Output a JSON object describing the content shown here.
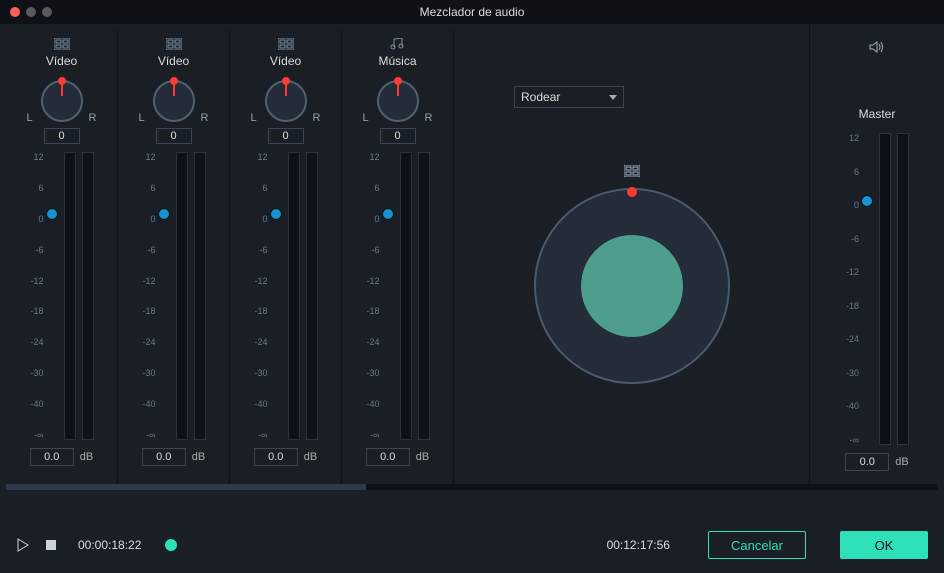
{
  "window": {
    "title": "Mezclador de audio"
  },
  "channels": [
    {
      "type": "video",
      "label": "Vídeo",
      "pan_value": "0",
      "db_value": "0.0",
      "db_label": "dB",
      "L": "L",
      "R": "R"
    },
    {
      "type": "video",
      "label": "Vídeo",
      "pan_value": "0",
      "db_value": "0.0",
      "db_label": "dB",
      "L": "L",
      "R": "R"
    },
    {
      "type": "video",
      "label": "Vídeo",
      "pan_value": "0",
      "db_value": "0.0",
      "db_label": "dB",
      "L": "L",
      "R": "R"
    },
    {
      "type": "music",
      "label": "Música",
      "pan_value": "0",
      "db_value": "0.0",
      "db_label": "dB",
      "L": "L",
      "R": "R"
    }
  ],
  "scale_labels": [
    "12",
    "6",
    "0",
    "-6",
    "-12",
    "-18",
    "-24",
    "-30",
    "-40",
    "-∞"
  ],
  "surround": {
    "mode": "Rodear"
  },
  "master": {
    "label": "Master",
    "db_value": "0.0",
    "db_label": "dB"
  },
  "transport": {
    "current": "00:00:18:22",
    "total": "00:12:17:56",
    "cancel": "Cancelar",
    "ok": "OK"
  },
  "colors": {
    "accent": "#2ee0b8",
    "danger": "#ff3b30",
    "primary_blue": "#1793d1"
  }
}
